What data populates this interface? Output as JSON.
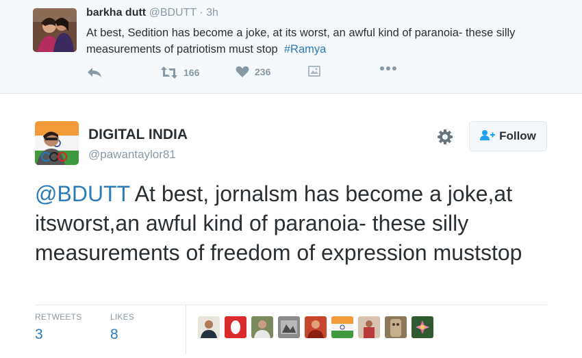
{
  "parent_tweet": {
    "author_name": "barkha dutt",
    "handle": "@BDUTT",
    "separator": "·",
    "time": "3h",
    "text_before": "At best, Sedition has become a joke, at its worst, an awful kind of paranoia- these silly measurements of patriotism must stop",
    "hashtag": "#Ramya",
    "actions": {
      "reply_icon": "reply-icon",
      "retweet_icon": "retweet-icon",
      "retweet_count": "166",
      "like_icon": "heart-icon",
      "like_count": "236",
      "media_icon": "image-icon",
      "more_icon": "more-dots-icon"
    }
  },
  "main_tweet": {
    "author_name": "DIGITAL INDIA",
    "handle": "@pawantaylor81",
    "follow_label": "Follow",
    "mention": "@BDUTT",
    "text": " At best, jornalsm has become a joke,at itsworst,an awful kind of paranoia- these silly measurements of freedom of expression muststop",
    "stats": {
      "retweets_label": "RETWEETS",
      "retweets_value": "3",
      "likes_label": "LIKES",
      "likes_value": "8"
    },
    "likers_count": 9
  },
  "colors": {
    "link": "#2b7bb9",
    "muted": "#8899a6",
    "text": "#292f33",
    "border": "#e1e8ed",
    "parent_bg": "#f5f8fa"
  }
}
